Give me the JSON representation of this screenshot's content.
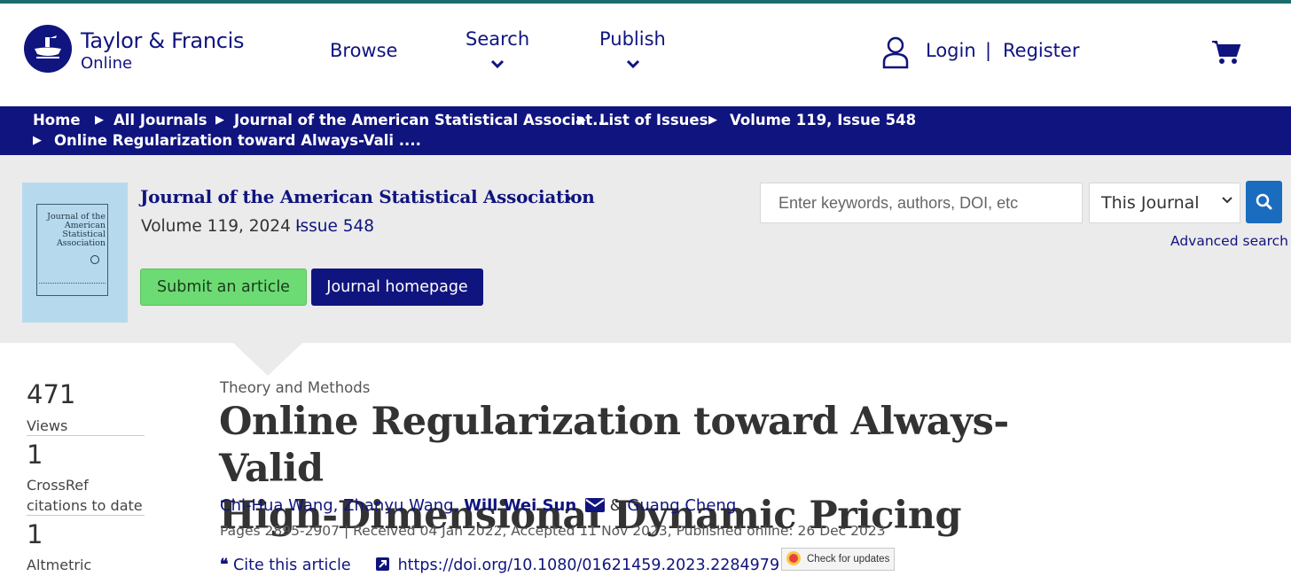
{
  "brand": {
    "name": "Taylor & Francis",
    "sub": "Online"
  },
  "nav": {
    "browse": "Browse",
    "search": "Search",
    "publish": "Publish"
  },
  "account": {
    "login": "Login",
    "separator": "|",
    "register": "Register"
  },
  "breadcrumb": {
    "items": [
      "Home",
      "All Journals",
      "Journal of the American Statistical Associat...",
      "List of Issues",
      "Volume 119, Issue 548",
      "Online Regularization toward Always-Vali ...."
    ]
  },
  "journal": {
    "title": "Journal of the American Statistical Association",
    "volume_text": "Volume 119, 2024 -",
    "issue_link": "Issue 548",
    "cover_title": "Journal of the American Statistical Association",
    "submit_label": "Submit an article",
    "homepage_label": "Journal homepage"
  },
  "search": {
    "placeholder": "Enter keywords, authors, DOI, etc",
    "scope": "This Journal",
    "advanced": "Advanced search"
  },
  "metrics": [
    {
      "value": "471",
      "label": "Views"
    },
    {
      "value": "1",
      "label": "CrossRef citations to date"
    },
    {
      "value": "1",
      "label": "Altmetric"
    }
  ],
  "article": {
    "category": "Theory and Methods",
    "title_line1": "Online Regularization toward Always-Valid",
    "title_line2": "High-Dimensional Dynamic Pricing",
    "authors": {
      "a1": "Chi-Hua Wang,",
      "a2": "Zhanyu Wang,",
      "a3": "Will Wei Sun",
      "amp": "&",
      "a4": "Guang Cheng"
    },
    "pub_info": "Pages 2895-2907 | Received 04 Jan 2022, Accepted 11 Nov 2023, Published online: 26 Dec 2023",
    "cite_label": "Cite this article",
    "doi": "https://doi.org/10.1080/01621459.2023.2284979",
    "check_updates": "Check for updates"
  },
  "colors": {
    "brand": "#10147e",
    "accent_green": "#6ddb74",
    "search_blue": "#1a6cbf",
    "banner_bg": "#ebebeb"
  },
  "icons": {
    "user": "user-icon",
    "cart": "cart-icon",
    "search": "search-icon",
    "email": "envelope-icon",
    "quote": "quote-icon",
    "external": "external-link-icon"
  }
}
